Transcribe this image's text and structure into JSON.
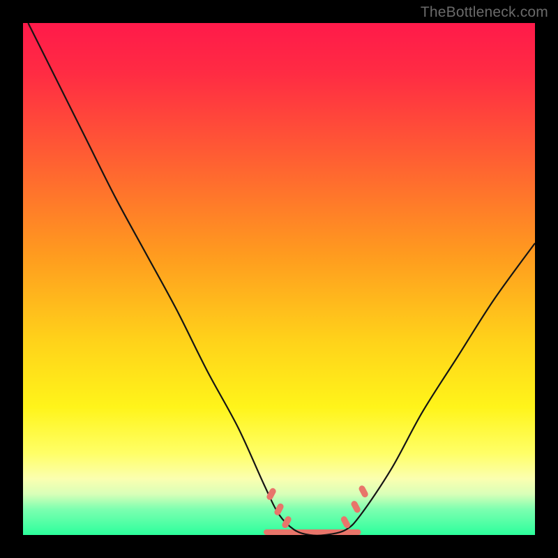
{
  "watermark": "TheBottleneck.com",
  "chart_data": {
    "type": "line",
    "title": "",
    "xlabel": "",
    "ylabel": "",
    "xlim": [
      0,
      100
    ],
    "ylim": [
      0,
      100
    ],
    "grid": false,
    "series": [
      {
        "name": "curve",
        "x": [
          1,
          6,
          12,
          18,
          24,
          30,
          36,
          42,
          47,
          50,
          53,
          56,
          59,
          63,
          66,
          72,
          78,
          85,
          92,
          100
        ],
        "y": [
          100,
          90,
          78,
          66,
          55,
          44,
          32,
          21,
          10,
          4,
          1,
          0,
          0,
          1,
          4,
          13,
          24,
          35,
          46,
          57
        ]
      }
    ],
    "valley_band_x": [
      47,
      66
    ],
    "markers": [
      {
        "x": 48.5,
        "y": 8
      },
      {
        "x": 50,
        "y": 5
      },
      {
        "x": 51.5,
        "y": 2.5
      },
      {
        "x": 63,
        "y": 2.5
      },
      {
        "x": 65,
        "y": 5.5
      },
      {
        "x": 66.5,
        "y": 8.5
      }
    ],
    "colors": {
      "gradient_stops": [
        {
          "pct": 0,
          "color": "#ff1a4a"
        },
        {
          "pct": 10,
          "color": "#ff2c43"
        },
        {
          "pct": 25,
          "color": "#ff5a34"
        },
        {
          "pct": 45,
          "color": "#ff9a1f"
        },
        {
          "pct": 62,
          "color": "#ffd21a"
        },
        {
          "pct": 75,
          "color": "#fff41a"
        },
        {
          "pct": 84,
          "color": "#ffff66"
        },
        {
          "pct": 89,
          "color": "#fbffb0"
        },
        {
          "pct": 92,
          "color": "#d9ffb8"
        },
        {
          "pct": 95,
          "color": "#7cffb0"
        },
        {
          "pct": 100,
          "color": "#2cff9c"
        }
      ],
      "curve": "#141414",
      "marker": "#e8756a"
    }
  }
}
